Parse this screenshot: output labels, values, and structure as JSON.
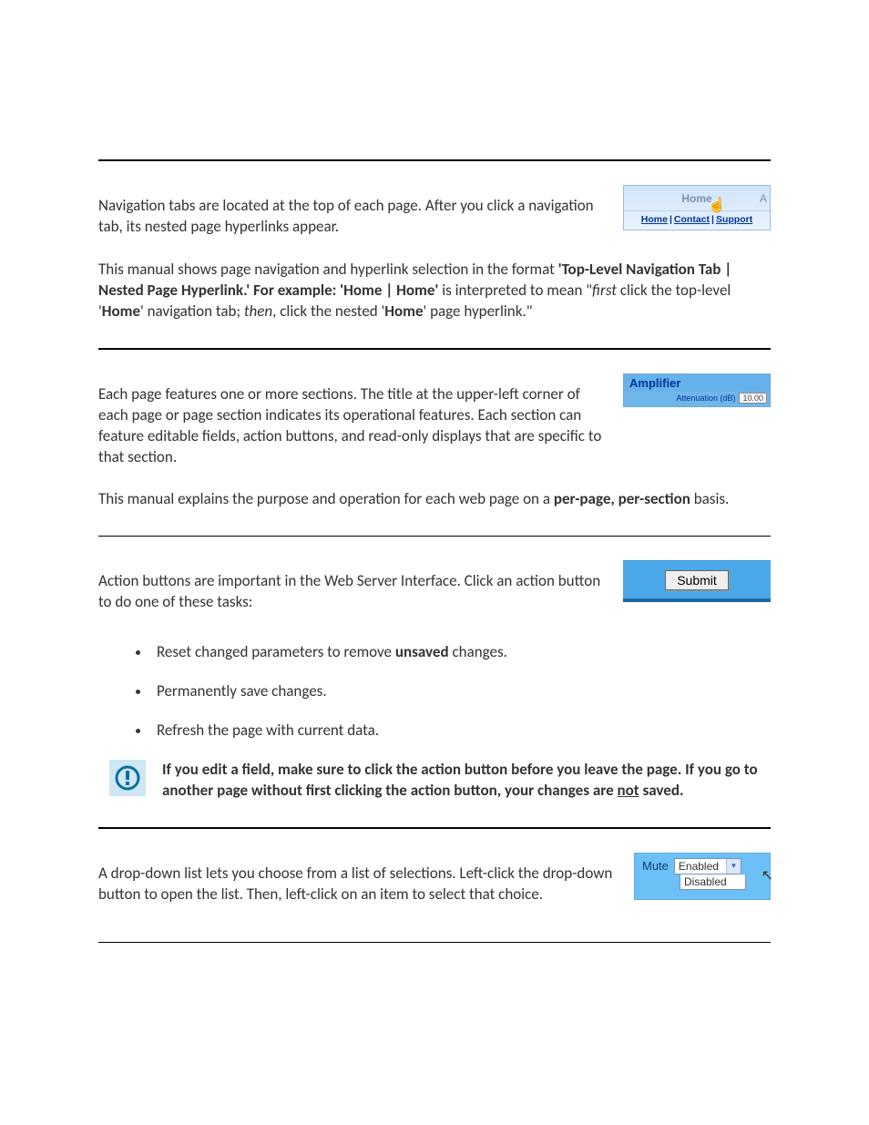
{
  "sec1": {
    "p1a": "Navigation tabs are located at the top of each page. After you click a navigation tab, its nested page hyperlinks appear.",
    "ill": {
      "tab_home": "Home",
      "tab_edge": "A",
      "link_home": "Home",
      "link_contact": "Contact",
      "link_support": "Support",
      "sep": "|"
    },
    "p2_pre": "This manual shows page navigation and hyperlink selection in the format ",
    "p2_b1": "'Top-Level Navigation Tab | Nested Page Hyperlink.' For example: 'Home | Home'",
    "p2_mid1": " is interpreted to mean \"",
    "p2_i1": "first",
    "p2_mid2": " click the top-level '",
    "p2_b2": "Home",
    "p2_mid3": "' navigation tab; ",
    "p2_i2": "then",
    "p2_mid4": ", click the nested '",
    "p2_b3": "Home",
    "p2_mid5": "' page hyperlink.\""
  },
  "sec2": {
    "p1": "Each page features one or more sections. The title at the upper-left corner of each page or page section indicates its operational features. Each section can feature editable fields, action buttons, and read-only displays that are specific to that section.",
    "ill": {
      "title": "Amplifier",
      "label": "Attenuation (dB)",
      "value": "10.00"
    },
    "p2_pre": "This manual explains the purpose and operation for each web page on a ",
    "p2_b": "per-page, per-section",
    "p2_post": " basis."
  },
  "sec3": {
    "p1": "Action buttons are important in the Web Server Interface. Click an action button to do one of these tasks:",
    "ill": {
      "btn": "Submit"
    },
    "bullets": {
      "b1_pre": "Reset changed parameters to remove ",
      "b1_b": "unsaved",
      "b1_post": " changes.",
      "b2": "Permanently save changes.",
      "b3": "Refresh the page with current data."
    },
    "note_pre": "If you edit a field, make sure to click the action button before you leave the page. If you go to another page without first clicking the action button, your changes are ",
    "note_u": "not",
    "note_post": " saved."
  },
  "sec4": {
    "p1": "A drop-down list lets you choose from a list of selections. Left-click the drop-down button to open the list. Then, left-click on an item to select that choice.",
    "ill": {
      "label": "Mute",
      "opt1": "Enabled",
      "opt2": "Disabled"
    }
  }
}
